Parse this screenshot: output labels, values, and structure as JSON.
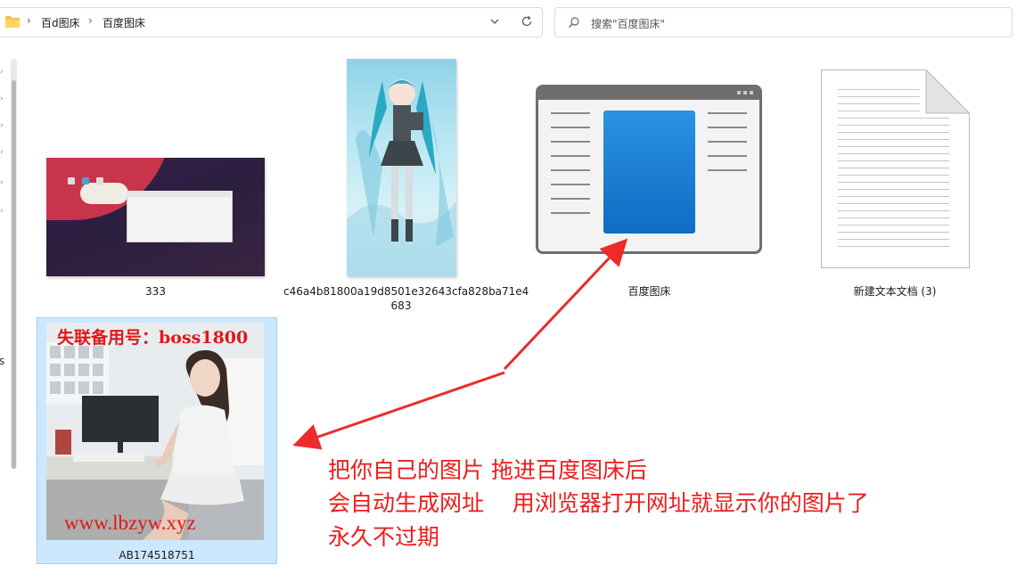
{
  "address_bar": {
    "crumbs": [
      "百d图床",
      "百度图床"
    ],
    "separator": "›"
  },
  "search": {
    "placeholder": "搜索\"百度图床\""
  },
  "left_pane": {
    "edge_text": "s"
  },
  "files": [
    {
      "name": "333",
      "type": "image"
    },
    {
      "name_line1": "c46a4b81800a19d8501e32643cfa828ba71e4",
      "name_line2": "683",
      "type": "image"
    },
    {
      "name": "百度图床",
      "type": "application"
    },
    {
      "name": "新建文本文档 (3)",
      "type": "text-document"
    },
    {
      "name": "AB174518751",
      "type": "image",
      "selected": true
    }
  ],
  "watermarks": {
    "top": "失联备用号：boss1800",
    "bottom": "www.lbzyw.xyz"
  },
  "annotation": {
    "line1": "把你自己的图片 拖进百度图床后",
    "line2": "会自动生成网址    用浏览器打开网址就显示你的图片了",
    "line3": "永久不过期",
    "color": "#ee1b1b"
  },
  "colors": {
    "selection_bg": "#cce8ff",
    "selection_border": "#99d1ff",
    "app_blue": "#1577d2"
  }
}
